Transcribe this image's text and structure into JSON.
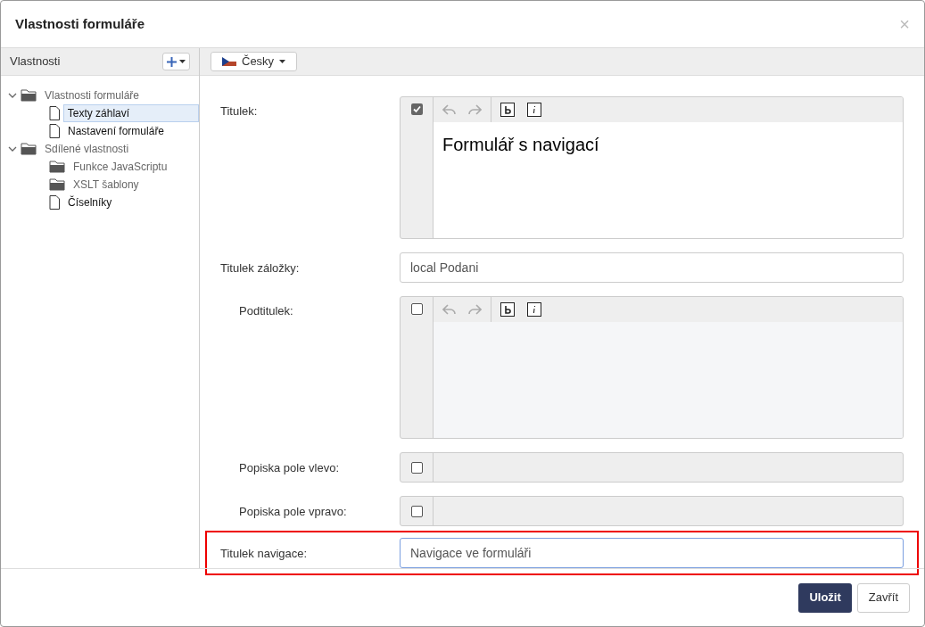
{
  "dialog": {
    "title": "Vlastnosti formuláře",
    "close": "×"
  },
  "sidebar": {
    "title": "Vlastnosti",
    "tree": [
      {
        "label": "Vlastnosti formuláře",
        "kind": "folder",
        "expanded": true,
        "selected": false,
        "children": [
          {
            "label": "Texty záhlaví",
            "kind": "file",
            "selected": true
          },
          {
            "label": "Nastavení formuláře",
            "kind": "file",
            "selected": false
          }
        ]
      },
      {
        "label": "Sdílené vlastnosti",
        "kind": "folder",
        "expanded": true,
        "selected": false,
        "children": [
          {
            "label": "Funkce JavaScriptu",
            "kind": "folder",
            "selected": false
          },
          {
            "label": "XSLT šablony",
            "kind": "folder",
            "selected": false
          },
          {
            "label": "Číselníky",
            "kind": "file",
            "selected": false
          }
        ]
      }
    ]
  },
  "language": {
    "label": "Česky"
  },
  "fields": [
    {
      "label": "Titulek:",
      "kind": "richtext",
      "indented": false,
      "checked": true,
      "value": "Formulář s navigací",
      "highlighted": false
    },
    {
      "label": "Titulek záložky:",
      "kind": "text",
      "indented": false,
      "value": "local Podani",
      "highlighted": false
    },
    {
      "label": "Podtitulek:",
      "kind": "richtext",
      "indented": true,
      "checked": false,
      "highlighted": false
    },
    {
      "label": "Popiska pole vlevo:",
      "kind": "checkline",
      "indented": true,
      "checked": false,
      "highlighted": false
    },
    {
      "label": "Popiska pole vpravo:",
      "kind": "checkline",
      "indented": true,
      "checked": false,
      "highlighted": false
    },
    {
      "label": "Titulek navigace:",
      "kind": "text",
      "indented": false,
      "value": "Navigace ve formuláři",
      "highlighted": true
    }
  ],
  "buttons": [
    {
      "label": "Uložit",
      "kind": "primary"
    },
    {
      "label": "Zavřít",
      "kind": "secondary"
    }
  ]
}
